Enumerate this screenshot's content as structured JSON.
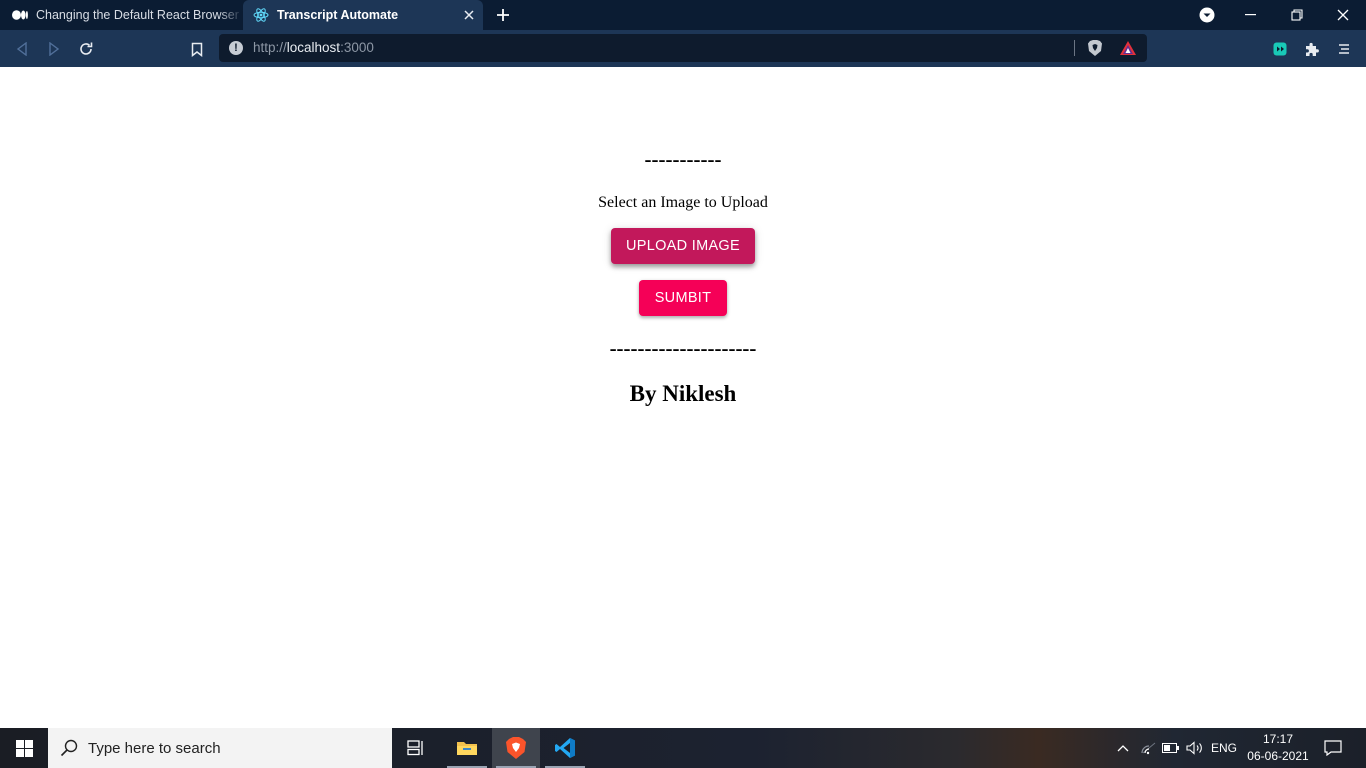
{
  "browser": {
    "tabs": [
      {
        "title": "Changing the Default React Browser Tab",
        "favicon": "medium-logo-icon",
        "active": false
      },
      {
        "title": "Transcript Automate",
        "favicon": "react-logo-icon",
        "active": true
      }
    ],
    "url": {
      "scheme": "http://",
      "host": "localhost",
      "port": ":3000"
    }
  },
  "page": {
    "divider_top": "-----------",
    "select_label": "Select an Image to Upload",
    "upload_button": "UPLOAD IMAGE",
    "submit_button": "SUMBIT",
    "divider_bottom": "---------------------",
    "author": "By Niklesh",
    "colors": {
      "upload": "#c2185b",
      "submit": "#f50057"
    }
  },
  "taskbar": {
    "search_placeholder": "Type here to search",
    "language": "ENG",
    "time": "17:17",
    "date": "06-06-2021",
    "pinned": [
      "task-view-icon",
      "file-explorer-icon",
      "brave-browser-icon",
      "vscode-icon"
    ]
  }
}
